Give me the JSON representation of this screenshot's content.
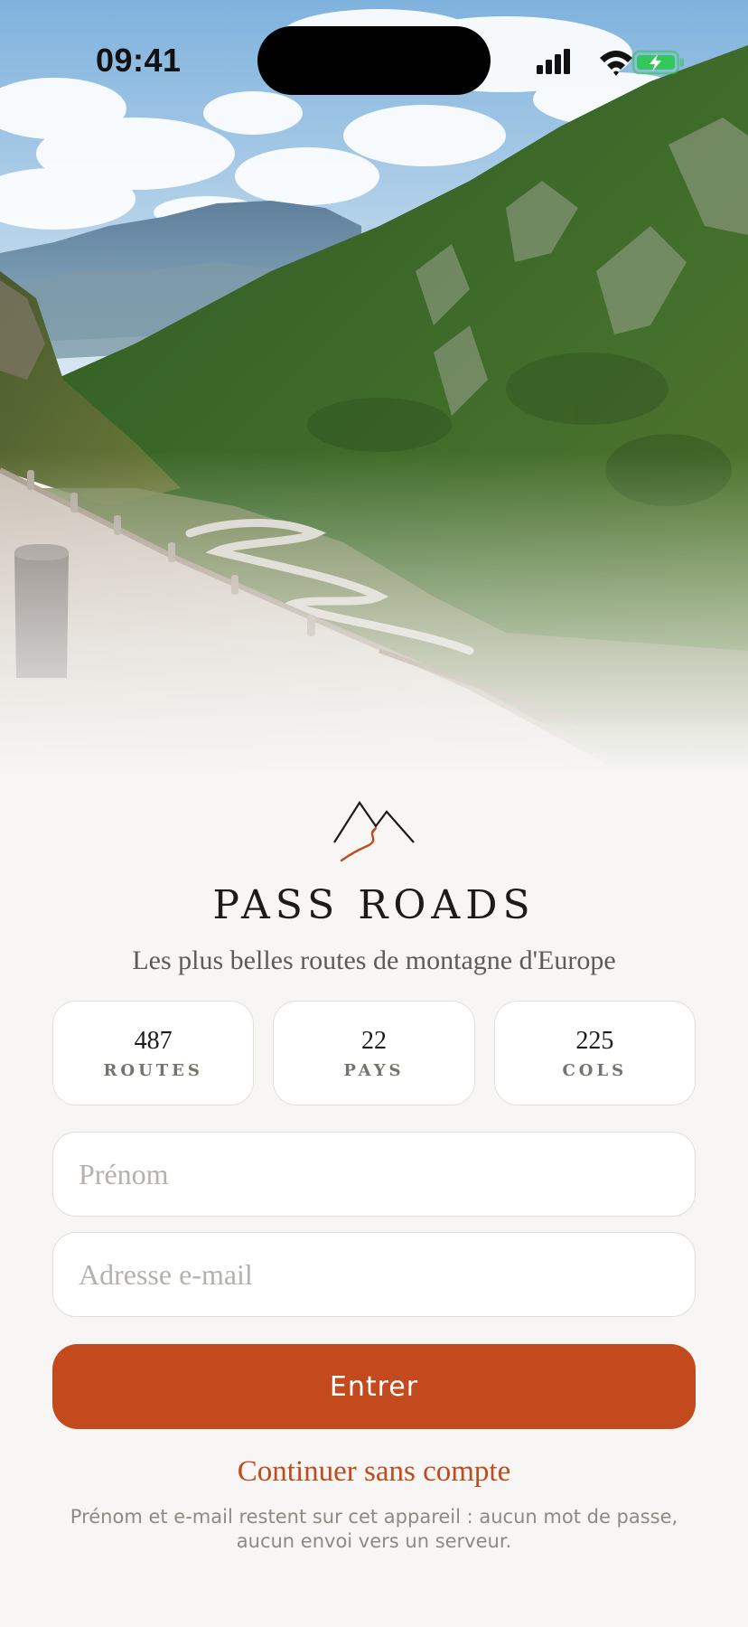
{
  "status_bar": {
    "time": "09:41",
    "icons": [
      "signal-icon",
      "wifi-icon",
      "battery-charging-icon"
    ],
    "battery_color": "#34c759"
  },
  "hero": {
    "image": "mountain-pass-road-photo"
  },
  "branding": {
    "app_name": "PASS ROADS",
    "tagline": "Les plus belles routes de montagne d'Europe",
    "logo_icon": "mountain-road-logo-icon",
    "accent_color": "#c24a1c"
  },
  "stats": [
    {
      "value": "487",
      "label": "ROUTES"
    },
    {
      "value": "22",
      "label": "PAYS"
    },
    {
      "value": "225",
      "label": "COLS"
    }
  ],
  "form": {
    "first_name_placeholder": "Prénom",
    "first_name_value": "",
    "email_placeholder": "Adresse e-mail",
    "email_value": "",
    "submit_label": "Entrer",
    "skip_label": "Continuer sans compte",
    "privacy_note": "Prénom et e-mail restent sur cet appareil : aucun mot de passe, aucun envoi vers un serveur."
  }
}
